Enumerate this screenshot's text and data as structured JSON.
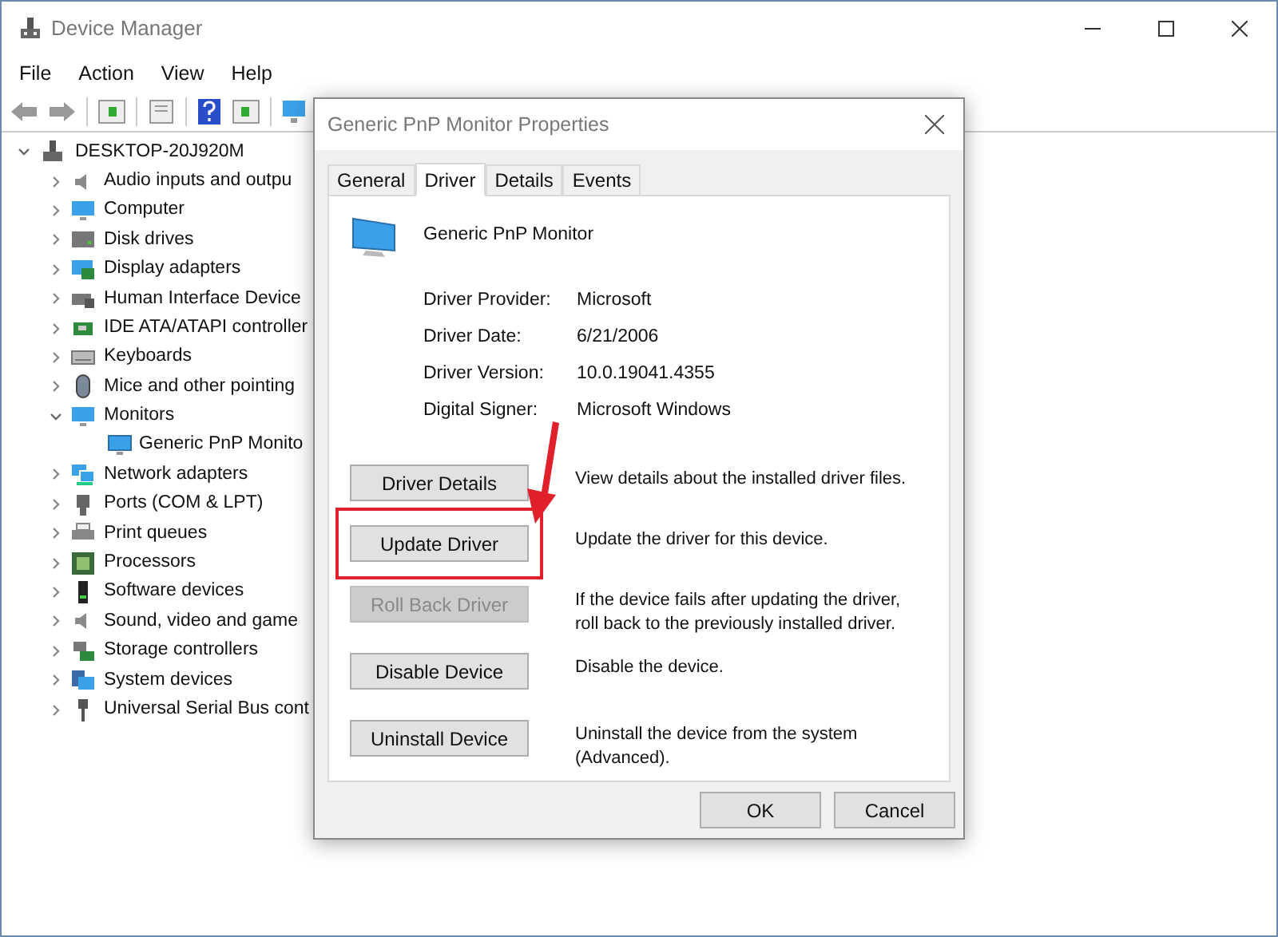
{
  "window": {
    "title": "Device Manager"
  },
  "menu": [
    "File",
    "Action",
    "View",
    "Help"
  ],
  "tree": {
    "label": "DESKTOP-20J920M",
    "expanded": true,
    "children": [
      {
        "label": "Audio inputs and outpu",
        "expanded": false
      },
      {
        "label": "Computer",
        "expanded": false
      },
      {
        "label": "Disk drives",
        "expanded": false
      },
      {
        "label": "Display adapters",
        "expanded": false
      },
      {
        "label": "Human Interface Device",
        "expanded": false
      },
      {
        "label": "IDE ATA/ATAPI controller",
        "expanded": false
      },
      {
        "label": "Keyboards",
        "expanded": false
      },
      {
        "label": "Mice and other pointing",
        "expanded": false
      },
      {
        "label": "Monitors",
        "expanded": true,
        "children": [
          {
            "label": "Generic PnP Monito"
          }
        ]
      },
      {
        "label": "Network adapters",
        "expanded": false
      },
      {
        "label": "Ports (COM & LPT)",
        "expanded": false
      },
      {
        "label": "Print queues",
        "expanded": false
      },
      {
        "label": "Processors",
        "expanded": false
      },
      {
        "label": "Software devices",
        "expanded": false
      },
      {
        "label": "Sound, video and game",
        "expanded": false
      },
      {
        "label": "Storage controllers",
        "expanded": false
      },
      {
        "label": "System devices",
        "expanded": false
      },
      {
        "label": "Universal Serial Bus cont",
        "expanded": false
      }
    ]
  },
  "dialog": {
    "title": "Generic PnP Monitor Properties",
    "tabs": [
      {
        "label": "General",
        "selected": false
      },
      {
        "label": "Driver",
        "selected": true
      },
      {
        "label": "Details",
        "selected": false
      },
      {
        "label": "Events",
        "selected": false
      }
    ],
    "device_name": "Generic PnP Monitor",
    "properties": [
      {
        "label": "Driver Provider:",
        "value": "Microsoft"
      },
      {
        "label": "Driver Date:",
        "value": "6/21/2006"
      },
      {
        "label": "Driver Version:",
        "value": "10.0.19041.4355"
      },
      {
        "label": "Digital Signer:",
        "value": "Microsoft Windows"
      }
    ],
    "actions": [
      {
        "button": "Driver Details",
        "description": "View details about the installed driver files.",
        "disabled": false,
        "highlighted": false
      },
      {
        "button": "Update Driver",
        "description": "Update the driver for this device.",
        "disabled": false,
        "highlighted": true
      },
      {
        "button": "Roll Back Driver",
        "description": "If the device fails after updating the driver, roll back to the previously installed driver.",
        "disabled": true,
        "highlighted": false
      },
      {
        "button": "Disable Device",
        "description": "Disable the device.",
        "disabled": false,
        "highlighted": false
      },
      {
        "button": "Uninstall Device",
        "description": "Uninstall the device from the system (Advanced).",
        "disabled": false,
        "highlighted": false
      }
    ],
    "buttons": [
      "OK",
      "Cancel"
    ]
  }
}
